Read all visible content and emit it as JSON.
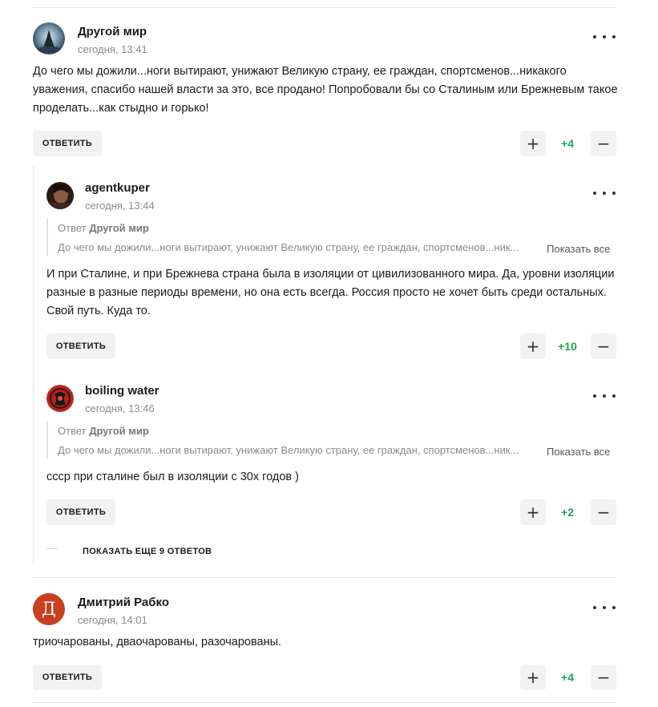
{
  "comments": [
    {
      "author": "Другой мир",
      "time": "сегодня, 13:41",
      "text": "До чего мы дожили...ноги вытирают, унижают Великую страну, ее граждан, спортсменов...никакого уважения, спасибо нашей власти за это, все продано! Попробовали бы со Сталиным или Брежневым такое проделать...как стыдно и горько!",
      "reply_label": "ответить",
      "score": "+4",
      "replies": [
        {
          "author": "agentkuper",
          "time": "сегодня, 13:44",
          "quote_prefix": "Ответ",
          "quote_author": "Другой мир",
          "quote_text": "До чего мы дожили...ноги вытирают, унижают Великую страну, ее граждан, спортсменов...ник...",
          "show_all": "Показать все",
          "text": "И при Сталине, и при Брежнева страна была в изоляции от цивилизованного мира. Да, уровни изоляции разные в разные периоды времени, но она есть всегда. Россия просто не хочет быть среди остальных. Свой путь. Куда то.",
          "reply_label": "ответить",
          "score": "+10"
        },
        {
          "author": "boiling water",
          "time": "сегодня, 13:46",
          "quote_prefix": "Ответ",
          "quote_author": "Другой мир",
          "quote_text": "До чего мы дожили...ноги вытирают, унижают Великую страну, ее граждан, спортсменов...ник...",
          "show_all": "Показать все",
          "text": "ссср при сталине был в изоляции с 30х годов )",
          "reply_label": "ответить",
          "score": "+2"
        }
      ],
      "more_replies": "Показать еще 9 ответов"
    },
    {
      "author": "Дмитрий Рабко",
      "avatar_letter": "Д",
      "avatar_color": "#c8401f",
      "time": "сегодня, 14:01",
      "text": "триочарованы, дваочарованы, разочарованы.",
      "reply_label": "ответить",
      "score": "+4"
    }
  ],
  "icons": {
    "upvote": "+",
    "downvote": "−",
    "menu": "more-dots-icon"
  },
  "colors": {
    "score": "#18a558",
    "button_bg": "#f2f2f2"
  }
}
